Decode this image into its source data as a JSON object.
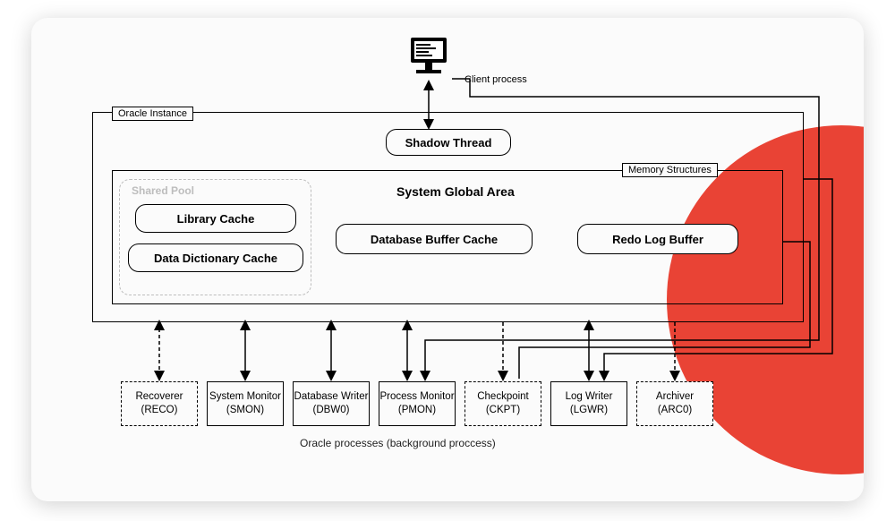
{
  "client_label": "Client process",
  "outer_label": "Oracle Instance",
  "memory_label": "Memory Structures",
  "shared_pool_label": "Shared Pool",
  "sga_title": "System Global Area",
  "shadow_thread": "Shadow Thread",
  "library_cache": "Library Cache",
  "data_dictionary_cache": "Data Dictionary Cache",
  "buffer_cache": "Database Buffer Cache",
  "redo_buffer": "Redo Log Buffer",
  "processes": {
    "reco": {
      "name": "Recoverer",
      "code": "(RECO)"
    },
    "smon": {
      "name": "System Monitor",
      "code": "(SMON)"
    },
    "dbw0": {
      "name": "Database Writer",
      "code": "(DBW0)"
    },
    "pmon": {
      "name": "Process Monitor",
      "code": "(PMON)"
    },
    "ckpt": {
      "name": "Checkpoint",
      "code": "(CKPT)"
    },
    "lgwr": {
      "name": "Log Writer",
      "code": "(LGWR)"
    },
    "arc0": {
      "name": "Archiver",
      "code": "(ARC0)"
    }
  },
  "caption": "Oracle processes (background proccess)"
}
